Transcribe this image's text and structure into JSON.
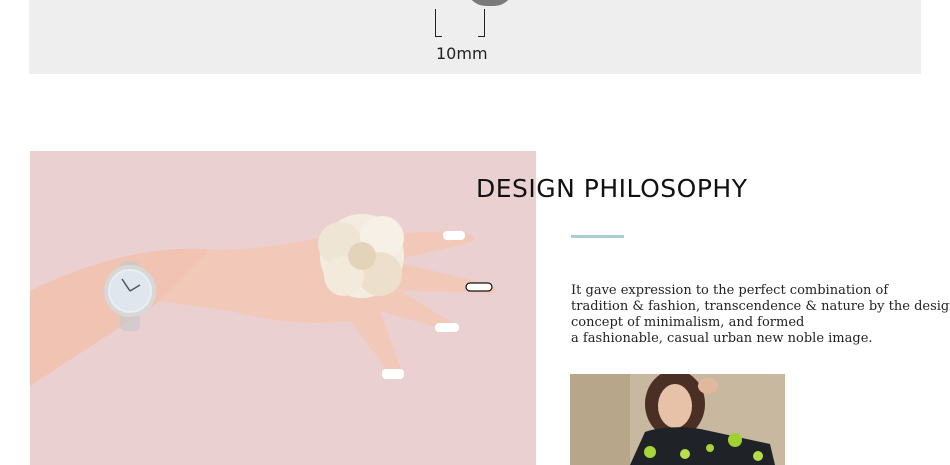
{
  "measurement": {
    "label": "10mm"
  },
  "design": {
    "title": "DESIGN  PHILOSOPHY",
    "description_lines": [
      "It gave expression to the perfect combination of",
      "tradition & fashion, transcendence & nature by the design",
      "concept of minimalism, and formed",
      "a fashionable, casual urban new noble image."
    ]
  },
  "colors": {
    "band_background": "#eeeeee",
    "accent_rule": "#a9ccd6",
    "photo_background": "#e8cccf"
  }
}
